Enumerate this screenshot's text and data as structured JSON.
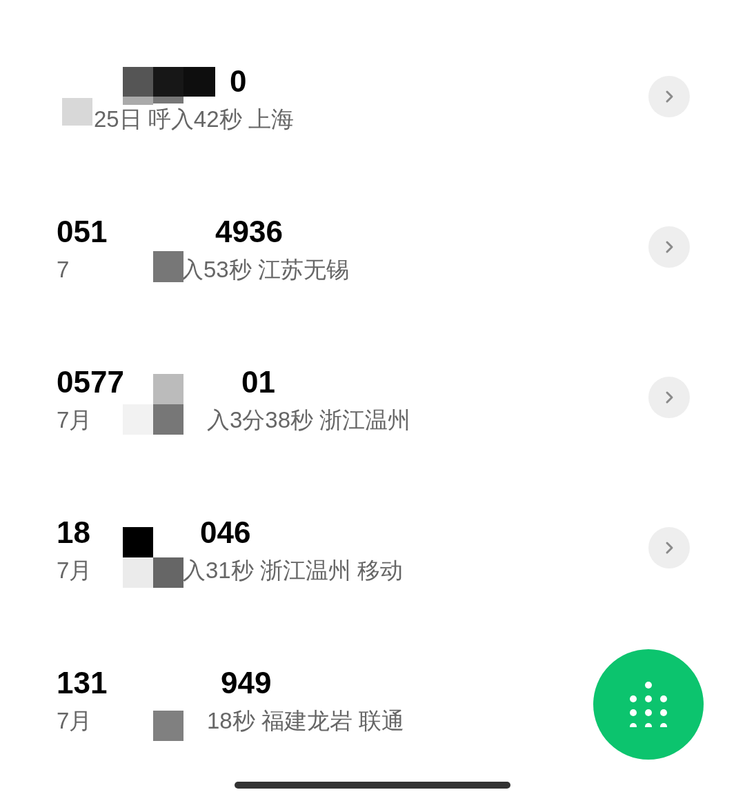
{
  "calls": [
    {
      "number_end": "0",
      "detail_end": "25日 呼入42秒 上海"
    },
    {
      "number_start": "051",
      "number_end": "4936",
      "detail_start": "7",
      "detail_end": "入53秒 江苏无锡"
    },
    {
      "number_start": "0577",
      "number_end": "01",
      "detail_start": "7月",
      "detail_end": "入3分38秒 浙江温州"
    },
    {
      "number_start": "18",
      "number_end": "046",
      "detail_start": "7月",
      "detail_end": "入31秒 浙江温州 移动"
    },
    {
      "number_start": "131",
      "number_end": "949",
      "detail_start": "7月",
      "detail_end": "18秒 福建龙岩 联通"
    }
  ]
}
